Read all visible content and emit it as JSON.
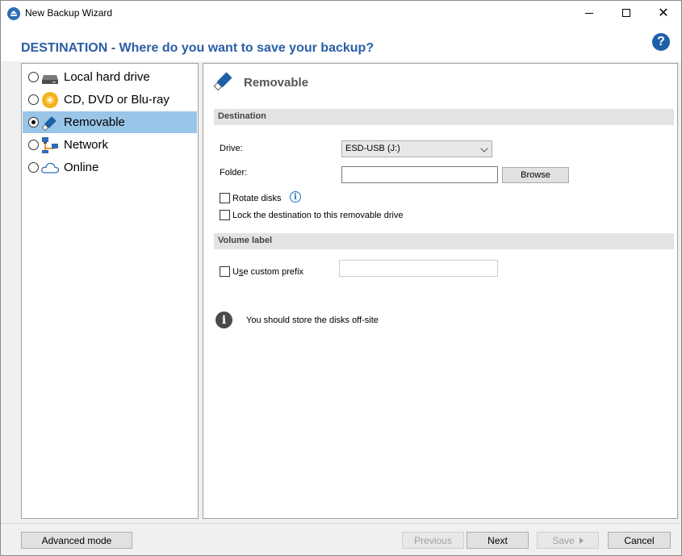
{
  "window": {
    "title": "New Backup Wizard",
    "minimize_glyph": "",
    "close_glyph": "✕"
  },
  "header": {
    "title": "DESTINATION - Where do you want to save your backup?",
    "help_glyph": "?"
  },
  "nav": {
    "items": [
      {
        "label": "Local hard drive",
        "icon": "hard-drive-icon",
        "selected": false
      },
      {
        "label": "CD, DVD or Blu-ray",
        "icon": "disc-icon",
        "selected": false
      },
      {
        "label": "Removable",
        "icon": "usb-drive-icon",
        "selected": true
      },
      {
        "label": "Network",
        "icon": "network-icon",
        "selected": false
      },
      {
        "label": "Online",
        "icon": "cloud-icon",
        "selected": false
      }
    ]
  },
  "panel": {
    "title": "Removable",
    "destination_section": "Destination",
    "drive_label": "Drive:",
    "drive_value": "ESD-USB (J:)",
    "folder_label": "Folder:",
    "folder_value": "",
    "browse_label": "Browse",
    "rotate_disks_label": "Rotate disks",
    "lock_destination_label": "Lock the destination to this removable drive",
    "volume_section": "Volume label",
    "custom_prefix_label_pre": "U",
    "custom_prefix_label_access": "s",
    "custom_prefix_label_post": "e custom prefix",
    "custom_prefix_value": "",
    "info_glyph": "i",
    "info_message": "You should store the disks off-site"
  },
  "footer": {
    "advanced_mode_label": "Advanced mode",
    "previous_label": "Previous",
    "next_label": "Next",
    "save_label": "Save",
    "cancel_label": "Cancel"
  },
  "colors": {
    "accent_blue": "#2a5ea6",
    "selection": "#99c5e8",
    "section_bar": "#e3e3e3"
  }
}
